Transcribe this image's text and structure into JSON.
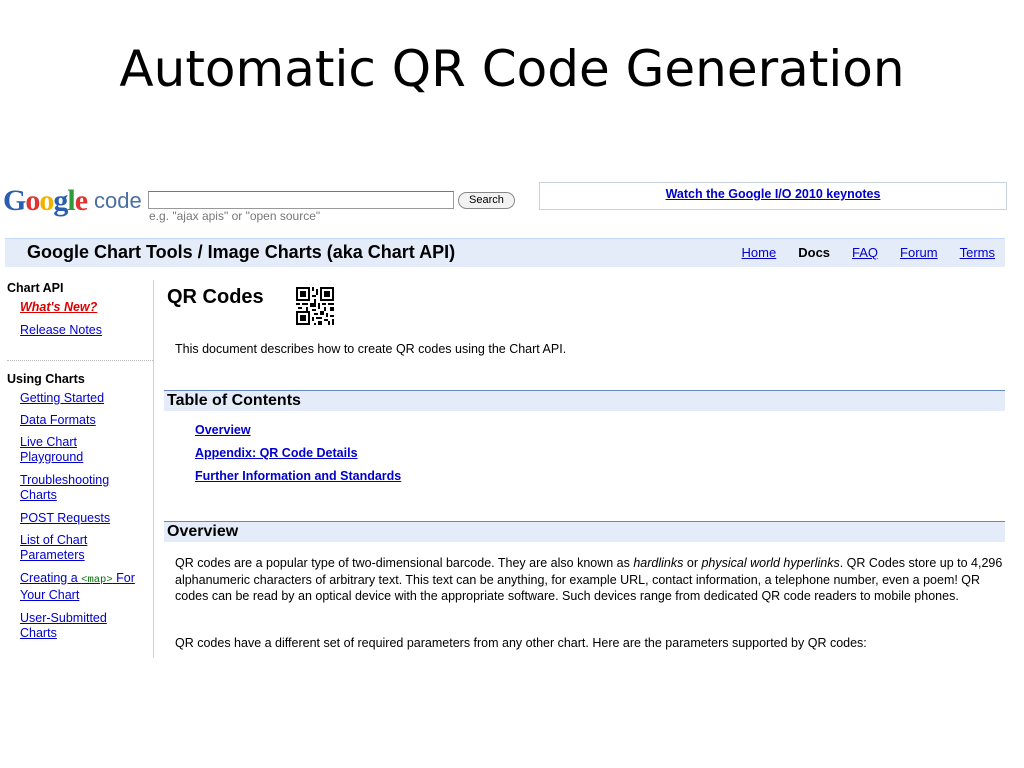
{
  "slide": {
    "title": "Automatic QR Code Generation"
  },
  "header": {
    "logo_parts": [
      "G",
      "o",
      "o",
      "g",
      "l",
      "e"
    ],
    "logo_suffix": "code",
    "search_value": "",
    "search_button": "Search",
    "search_hint": "e.g. \"ajax apis\" or \"open source\"",
    "promo_link": "Watch the Google I/O 2010 keynotes"
  },
  "title_bar": {
    "title": "Google Chart Tools / Image Charts (aka Chart API)",
    "nav": [
      {
        "label": "Home",
        "current": false
      },
      {
        "label": "Docs",
        "current": true
      },
      {
        "label": "FAQ",
        "current": false
      },
      {
        "label": "Forum",
        "current": false
      },
      {
        "label": "Terms",
        "current": false
      }
    ]
  },
  "sidebar": {
    "section1": {
      "heading": "Chart API",
      "items": [
        "What's New?",
        "Release Notes"
      ]
    },
    "section2": {
      "heading": "Using Charts",
      "items": [
        {
          "line1": "Getting Started"
        },
        {
          "line1": "Data Formats"
        },
        {
          "line1": "Live Chart",
          "line2": "Playground"
        },
        {
          "line1": "Troubleshooting",
          "line2": "Charts"
        },
        {
          "line1": "POST Requests"
        },
        {
          "line1": "List of Chart",
          "line2": "Parameters"
        },
        {
          "line1_pre": "Creating a ",
          "line1_code": "<map>",
          "line1_post": " For",
          "line2": "Your Chart"
        },
        {
          "line1": "User-Submitted",
          "line2": "Charts"
        }
      ]
    }
  },
  "main": {
    "page_title": "QR Codes",
    "intro": "This document describes how to create QR codes using the Chart API.",
    "toc_title": "Table of Contents",
    "toc": [
      "Overview",
      "Appendix: QR Code Details",
      "Further Information and Standards"
    ],
    "overview_title": "Overview",
    "overview_p1": {
      "a": "QR codes are a popular type of two-dimensional barcode. They are also known as ",
      "em1": "hardlinks",
      "b": " or ",
      "em2": "physical world hyperlinks",
      "c": ". QR Codes store up to 4,296 alphanumeric characters of arbitrary text. This text can be anything, for example URL, contact information, a telephone number, even a poem! QR codes can be read by an optical device with the appropriate software. Such devices range from dedicated QR code readers to mobile phones."
    },
    "overview_p2": "QR codes have a different set of required parameters from any other chart. Here are the parameters supported by QR codes:"
  }
}
